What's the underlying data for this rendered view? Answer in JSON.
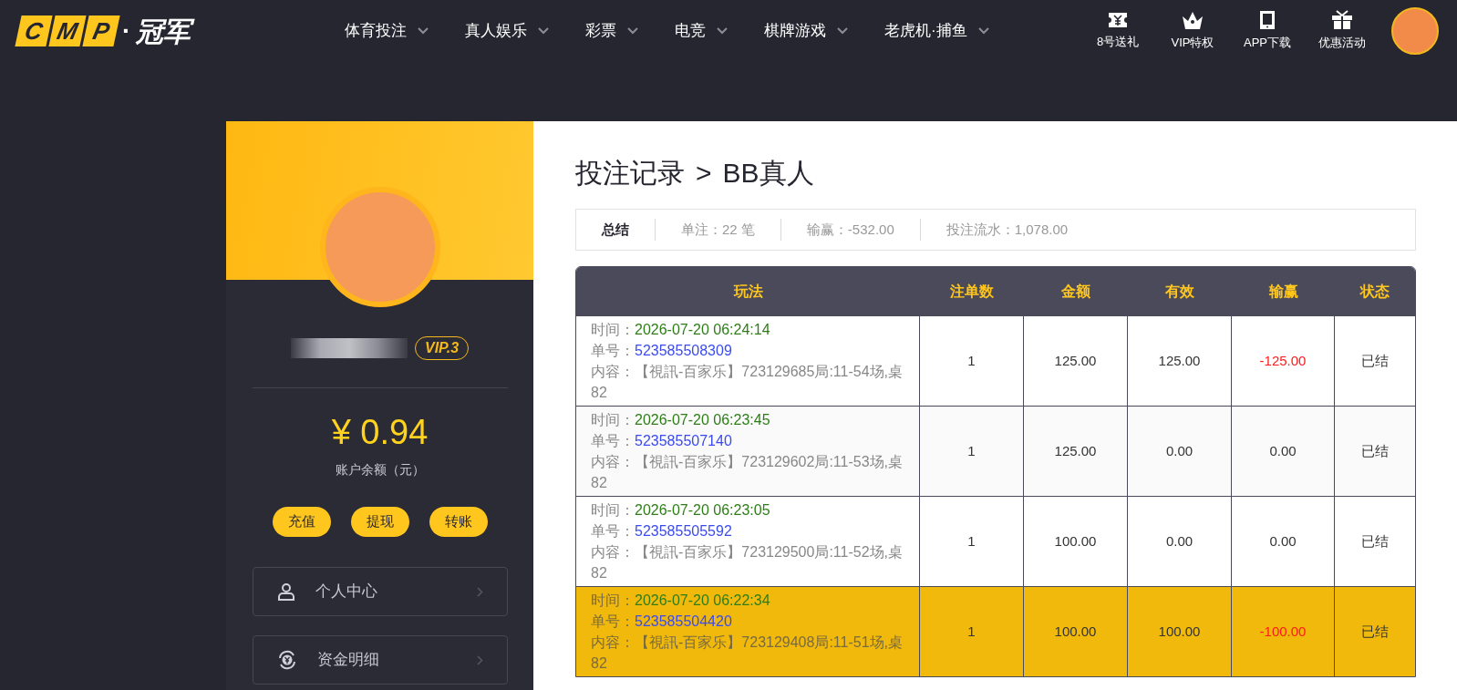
{
  "header": {
    "logo": {
      "mark": [
        "C",
        "M",
        "P"
      ],
      "dot": "·",
      "name": "冠军"
    },
    "nav": [
      {
        "label": "体育投注"
      },
      {
        "label": "真人娱乐"
      },
      {
        "label": "彩票"
      },
      {
        "label": "电竞"
      },
      {
        "label": "棋牌游戏"
      },
      {
        "label": "老虎机·捕鱼"
      }
    ],
    "actions": [
      {
        "kind": "ticket",
        "label": "8号送礼"
      },
      {
        "kind": "crown",
        "label": "VIP特权"
      },
      {
        "kind": "tablet",
        "label": "APP下载"
      },
      {
        "kind": "gift",
        "label": "优惠活动"
      }
    ]
  },
  "sidebar": {
    "vip": "VIP.3",
    "balance": "¥ 0.94",
    "balance_label": "账户余额（元）",
    "buttons": [
      "充值",
      "提现",
      "转账"
    ],
    "menu": [
      {
        "kind": "user",
        "label": "个人中心"
      },
      {
        "kind": "funds",
        "label": "资金明细"
      }
    ]
  },
  "main": {
    "breadcrumb": [
      {
        "label": "投注记录"
      },
      {
        "label": ">"
      },
      {
        "label": "BB真人"
      }
    ],
    "summary": [
      {
        "label": "总结",
        "bold": true
      },
      {
        "label": "单注：22 笔",
        "bold": false
      },
      {
        "label": "输赢：-532.00",
        "bold": false
      },
      {
        "label": "投注流水：1,078.00",
        "bold": false
      }
    ],
    "table": {
      "columns": [
        "玩法",
        "注单数",
        "金额",
        "有效",
        "输赢",
        "状态"
      ],
      "rows": [
        {
          "selected": false,
          "time_label": "时间：",
          "time": "2026-07-20 06:24:14",
          "order_label": "单号：",
          "order": "523585508309",
          "content_label": "内容：",
          "content": "【視訊-百家乐】723129685局:11-54场,桌82",
          "count": "1",
          "amount": "125.00",
          "valid": "125.00",
          "result": "-125.00",
          "negative": true,
          "status": "已结"
        },
        {
          "selected": false,
          "time_label": "时间：",
          "time": "2026-07-20 06:23:45",
          "order_label": "单号：",
          "order": "523585507140",
          "content_label": "内容：",
          "content": "【視訊-百家乐】723129602局:11-53场,桌82",
          "count": "1",
          "amount": "125.00",
          "valid": "0.00",
          "result": "0.00",
          "negative": false,
          "status": "已结"
        },
        {
          "selected": false,
          "time_label": "时间：",
          "time": "2026-07-20 06:23:05",
          "order_label": "单号：",
          "order": "523585505592",
          "content_label": "内容：",
          "content": "【視訊-百家乐】723129500局:11-52场,桌82",
          "count": "1",
          "amount": "100.00",
          "valid": "0.00",
          "result": "0.00",
          "negative": false,
          "status": "已结"
        },
        {
          "selected": true,
          "time_label": "时间：",
          "time": "2026-07-20 06:22:34",
          "order_label": "单号：",
          "order": "523585504420",
          "content_label": "内容：",
          "content": "【視訊-百家乐】723129408局:11-51场,桌82",
          "count": "1",
          "amount": "100.00",
          "valid": "100.00",
          "result": "-100.00",
          "negative": true,
          "status": "已结"
        }
      ]
    }
  }
}
